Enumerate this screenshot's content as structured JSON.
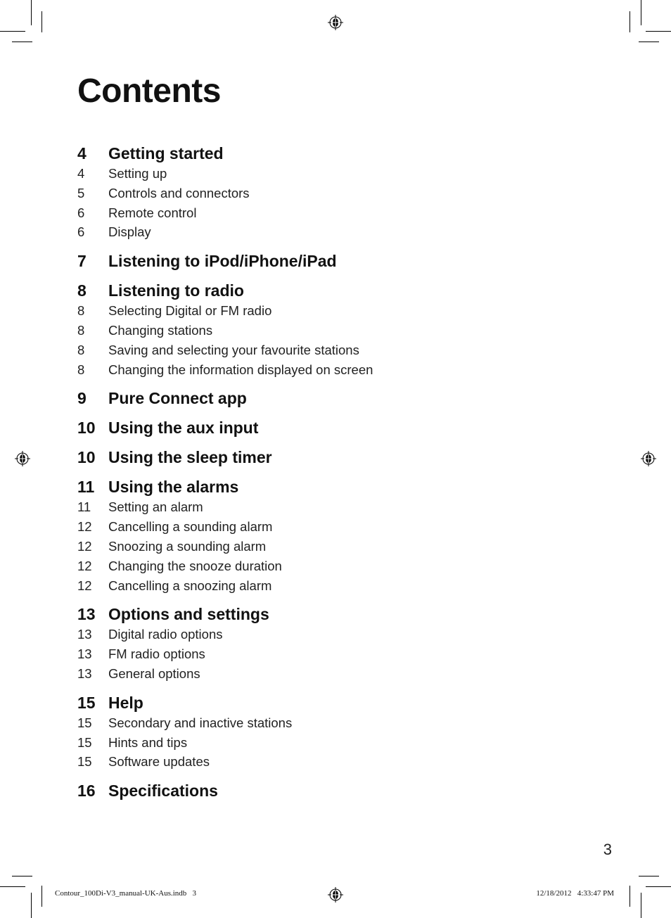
{
  "title": "Contents",
  "sections": [
    {
      "page": "4",
      "title": "Getting started",
      "items": [
        {
          "page": "4",
          "title": "Setting up"
        },
        {
          "page": "5",
          "title": "Controls and connectors"
        },
        {
          "page": "6",
          "title": "Remote control"
        },
        {
          "page": "6",
          "title": "Display"
        }
      ]
    },
    {
      "page": "7",
      "title": "Listening to iPod/iPhone/iPad",
      "items": []
    },
    {
      "page": "8",
      "title": "Listening to radio",
      "items": [
        {
          "page": "8",
          "title": "Selecting Digital or FM radio"
        },
        {
          "page": "8",
          "title": "Changing stations"
        },
        {
          "page": "8",
          "title": "Saving and selecting your favourite stations"
        },
        {
          "page": "8",
          "title": "Changing the information displayed on screen"
        }
      ]
    },
    {
      "page": "9",
      "title": "Pure Connect app",
      "items": []
    },
    {
      "page": "10",
      "title": "Using the aux input",
      "items": []
    },
    {
      "page": "10",
      "title": "Using the sleep timer",
      "items": []
    },
    {
      "page": "11",
      "title": "Using the alarms",
      "items": [
        {
          "page": "11",
          "title": "Setting an alarm"
        },
        {
          "page": "12",
          "title": "Cancelling a sounding alarm"
        },
        {
          "page": "12",
          "title": "Snoozing a sounding alarm"
        },
        {
          "page": "12",
          "title": "Changing the snooze duration"
        },
        {
          "page": "12",
          "title": "Cancelling a snoozing alarm"
        }
      ]
    },
    {
      "page": "13",
      "title": "Options and settings",
      "items": [
        {
          "page": "13",
          "title": "Digital radio options"
        },
        {
          "page": "13",
          "title": "FM radio options"
        },
        {
          "page": "13",
          "title": "General options"
        }
      ]
    },
    {
      "page": "15",
      "title": "Help",
      "items": [
        {
          "page": "15",
          "title": "Secondary and inactive stations"
        },
        {
          "page": "15",
          "title": "Hints and tips"
        },
        {
          "page": "15",
          "title": "Software updates"
        }
      ]
    },
    {
      "page": "16",
      "title": "Specifications",
      "items": []
    }
  ],
  "page_number": "3",
  "slug": {
    "file": "Contour_100Di-V3_manual-UK-Aus.indb   3",
    "timestamp": "12/18/2012   4:33:47 PM"
  },
  "icons": {
    "registration_mark": "registration-mark-icon"
  }
}
